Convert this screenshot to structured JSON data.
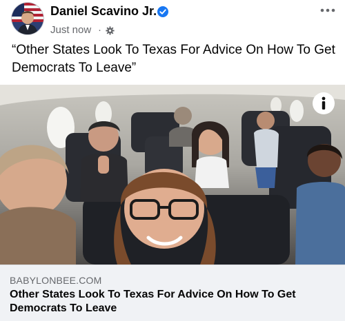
{
  "post": {
    "author_name": "Daniel Scavino Jr.",
    "timestamp": "Just now",
    "separator": "·",
    "text": "“Other States Look To Texas For Advice On How To Get Democrats To Leave”"
  },
  "link_preview": {
    "domain": "BABYLONBEE.COM",
    "title": "Other States Look To Texas For Advice On How To Get Democrats To Leave"
  },
  "icons": {
    "verified": "verified-badge-icon",
    "audience": "public-audience-gear-icon",
    "more": "more-options-icon",
    "info": "info-icon"
  },
  "colors": {
    "verified_blue": "#1877f2",
    "secondary_text": "#65676b",
    "preview_background": "#f0f2f5"
  }
}
